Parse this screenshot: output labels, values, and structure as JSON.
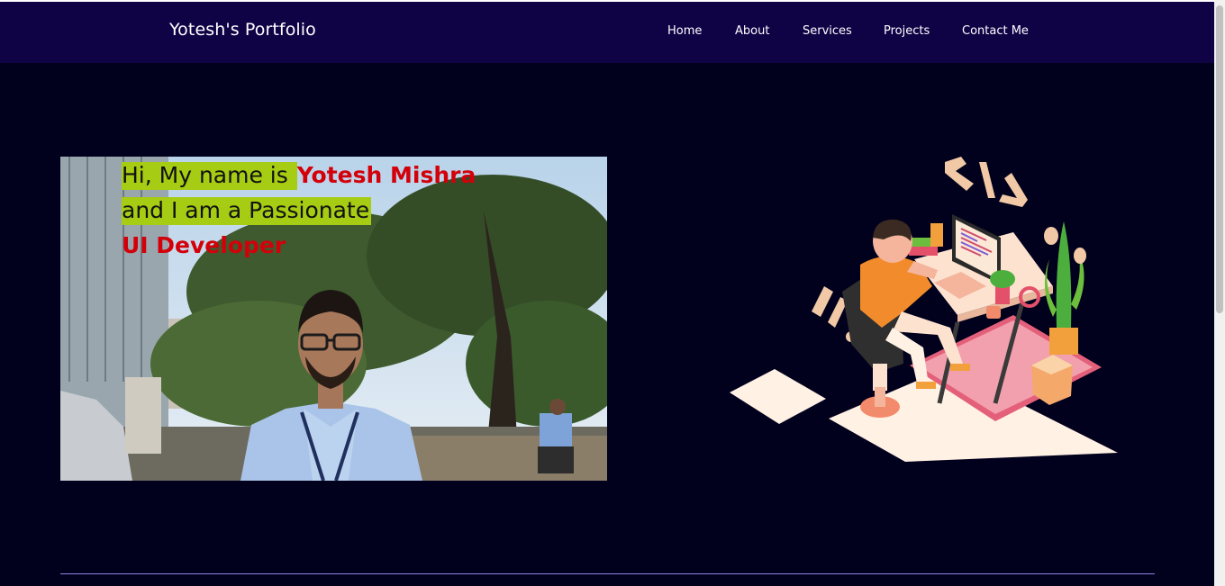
{
  "header": {
    "brand": "Yotesh's Portfolio",
    "nav": [
      {
        "label": "Home"
      },
      {
        "label": "About"
      },
      {
        "label": "Services"
      },
      {
        "label": "Projects"
      },
      {
        "label": "Contact Me"
      }
    ]
  },
  "hero": {
    "line1_prefix": "Hi, My name is ",
    "name": "Yotesh Mishra",
    "line2": "and I am a Passionate",
    "role": "UI Developer"
  },
  "colors": {
    "background": "#01001d",
    "navbar": "#0f0346",
    "highlight": "#a6cc13",
    "accent_red": "#d3000a",
    "divider": "#8b86e0"
  },
  "icons": {
    "illustration": "developer-at-desk-illustration",
    "photo": "profile-photo"
  }
}
